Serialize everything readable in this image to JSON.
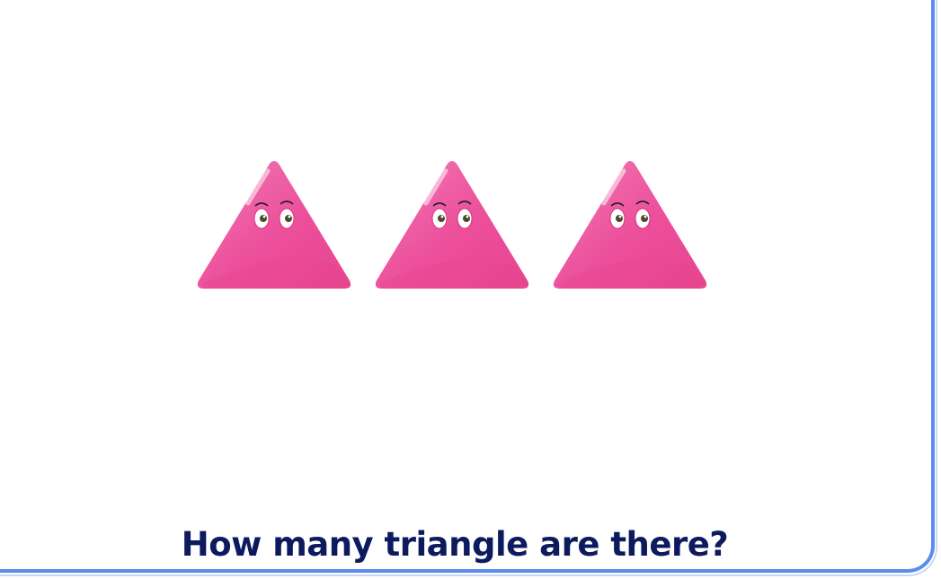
{
  "question": {
    "text": "How many triangle are there?"
  },
  "illustration": {
    "shape": "triangle",
    "count": 3,
    "color": "#ec4f9b",
    "highlight_color": "#f27bb5",
    "eye_icon": "cartoon-eyes-icon"
  },
  "theme": {
    "border_color": "#5b8def",
    "text_color": "#0d1b5e",
    "background": "#ffffff"
  }
}
